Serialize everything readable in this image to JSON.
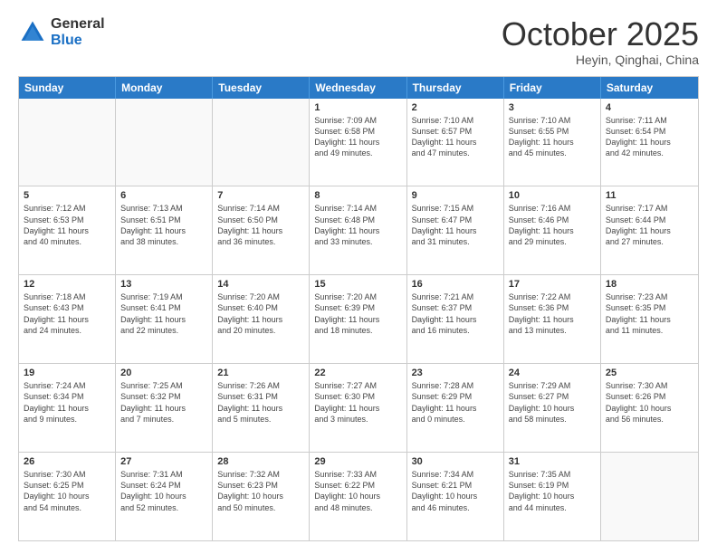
{
  "logo": {
    "general": "General",
    "blue": "Blue"
  },
  "title": "October 2025",
  "subtitle": "Heyin, Qinghai, China",
  "days": [
    "Sunday",
    "Monday",
    "Tuesday",
    "Wednesday",
    "Thursday",
    "Friday",
    "Saturday"
  ],
  "rows": [
    [
      {
        "day": "",
        "info": ""
      },
      {
        "day": "",
        "info": ""
      },
      {
        "day": "",
        "info": ""
      },
      {
        "day": "1",
        "info": "Sunrise: 7:09 AM\nSunset: 6:58 PM\nDaylight: 11 hours\nand 49 minutes."
      },
      {
        "day": "2",
        "info": "Sunrise: 7:10 AM\nSunset: 6:57 PM\nDaylight: 11 hours\nand 47 minutes."
      },
      {
        "day": "3",
        "info": "Sunrise: 7:10 AM\nSunset: 6:55 PM\nDaylight: 11 hours\nand 45 minutes."
      },
      {
        "day": "4",
        "info": "Sunrise: 7:11 AM\nSunset: 6:54 PM\nDaylight: 11 hours\nand 42 minutes."
      }
    ],
    [
      {
        "day": "5",
        "info": "Sunrise: 7:12 AM\nSunset: 6:53 PM\nDaylight: 11 hours\nand 40 minutes."
      },
      {
        "day": "6",
        "info": "Sunrise: 7:13 AM\nSunset: 6:51 PM\nDaylight: 11 hours\nand 38 minutes."
      },
      {
        "day": "7",
        "info": "Sunrise: 7:14 AM\nSunset: 6:50 PM\nDaylight: 11 hours\nand 36 minutes."
      },
      {
        "day": "8",
        "info": "Sunrise: 7:14 AM\nSunset: 6:48 PM\nDaylight: 11 hours\nand 33 minutes."
      },
      {
        "day": "9",
        "info": "Sunrise: 7:15 AM\nSunset: 6:47 PM\nDaylight: 11 hours\nand 31 minutes."
      },
      {
        "day": "10",
        "info": "Sunrise: 7:16 AM\nSunset: 6:46 PM\nDaylight: 11 hours\nand 29 minutes."
      },
      {
        "day": "11",
        "info": "Sunrise: 7:17 AM\nSunset: 6:44 PM\nDaylight: 11 hours\nand 27 minutes."
      }
    ],
    [
      {
        "day": "12",
        "info": "Sunrise: 7:18 AM\nSunset: 6:43 PM\nDaylight: 11 hours\nand 24 minutes."
      },
      {
        "day": "13",
        "info": "Sunrise: 7:19 AM\nSunset: 6:41 PM\nDaylight: 11 hours\nand 22 minutes."
      },
      {
        "day": "14",
        "info": "Sunrise: 7:20 AM\nSunset: 6:40 PM\nDaylight: 11 hours\nand 20 minutes."
      },
      {
        "day": "15",
        "info": "Sunrise: 7:20 AM\nSunset: 6:39 PM\nDaylight: 11 hours\nand 18 minutes."
      },
      {
        "day": "16",
        "info": "Sunrise: 7:21 AM\nSunset: 6:37 PM\nDaylight: 11 hours\nand 16 minutes."
      },
      {
        "day": "17",
        "info": "Sunrise: 7:22 AM\nSunset: 6:36 PM\nDaylight: 11 hours\nand 13 minutes."
      },
      {
        "day": "18",
        "info": "Sunrise: 7:23 AM\nSunset: 6:35 PM\nDaylight: 11 hours\nand 11 minutes."
      }
    ],
    [
      {
        "day": "19",
        "info": "Sunrise: 7:24 AM\nSunset: 6:34 PM\nDaylight: 11 hours\nand 9 minutes."
      },
      {
        "day": "20",
        "info": "Sunrise: 7:25 AM\nSunset: 6:32 PM\nDaylight: 11 hours\nand 7 minutes."
      },
      {
        "day": "21",
        "info": "Sunrise: 7:26 AM\nSunset: 6:31 PM\nDaylight: 11 hours\nand 5 minutes."
      },
      {
        "day": "22",
        "info": "Sunrise: 7:27 AM\nSunset: 6:30 PM\nDaylight: 11 hours\nand 3 minutes."
      },
      {
        "day": "23",
        "info": "Sunrise: 7:28 AM\nSunset: 6:29 PM\nDaylight: 11 hours\nand 0 minutes."
      },
      {
        "day": "24",
        "info": "Sunrise: 7:29 AM\nSunset: 6:27 PM\nDaylight: 10 hours\nand 58 minutes."
      },
      {
        "day": "25",
        "info": "Sunrise: 7:30 AM\nSunset: 6:26 PM\nDaylight: 10 hours\nand 56 minutes."
      }
    ],
    [
      {
        "day": "26",
        "info": "Sunrise: 7:30 AM\nSunset: 6:25 PM\nDaylight: 10 hours\nand 54 minutes."
      },
      {
        "day": "27",
        "info": "Sunrise: 7:31 AM\nSunset: 6:24 PM\nDaylight: 10 hours\nand 52 minutes."
      },
      {
        "day": "28",
        "info": "Sunrise: 7:32 AM\nSunset: 6:23 PM\nDaylight: 10 hours\nand 50 minutes."
      },
      {
        "day": "29",
        "info": "Sunrise: 7:33 AM\nSunset: 6:22 PM\nDaylight: 10 hours\nand 48 minutes."
      },
      {
        "day": "30",
        "info": "Sunrise: 7:34 AM\nSunset: 6:21 PM\nDaylight: 10 hours\nand 46 minutes."
      },
      {
        "day": "31",
        "info": "Sunrise: 7:35 AM\nSunset: 6:19 PM\nDaylight: 10 hours\nand 44 minutes."
      },
      {
        "day": "",
        "info": ""
      }
    ]
  ]
}
